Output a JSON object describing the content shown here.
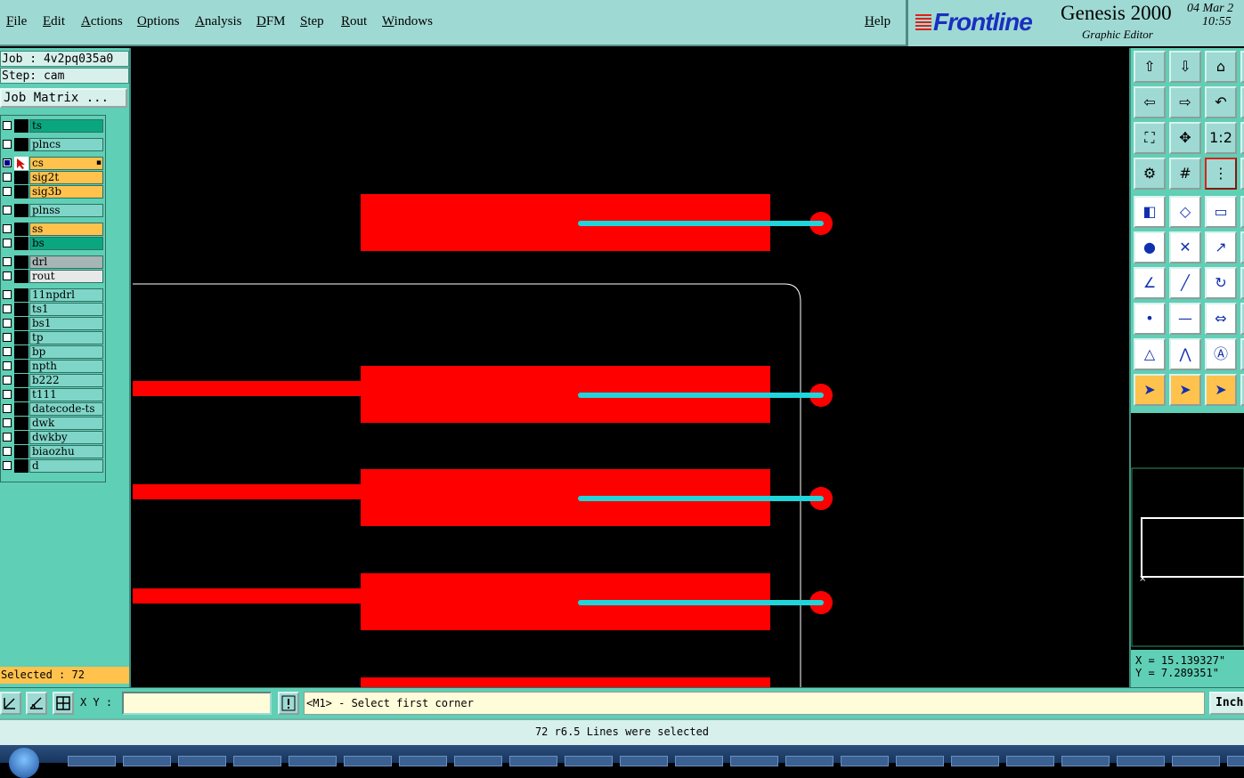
{
  "menu": {
    "items": [
      "File",
      "Edit",
      "Actions",
      "Options",
      "Analysis",
      "DFM",
      "Step",
      "Rout",
      "Windows"
    ],
    "help": "Help"
  },
  "brand": {
    "logo": "Frontline",
    "product": "Genesis 2000",
    "subtitle": "Graphic Editor",
    "date": "04 Mar 2",
    "time": "10:55"
  },
  "job": {
    "job_line": "Job : 4v2pq035a0",
    "step_line": "Step: cam",
    "matrix_button": "Job Matrix ..."
  },
  "layers": [
    {
      "name": "ts",
      "color": "#0aa680"
    },
    {
      "name": "plncs",
      "color": "#7fd6c8"
    },
    {
      "name": "cs",
      "color": "#ffc24d",
      "active": true
    },
    {
      "name": "sig2t",
      "color": "#ffc24d"
    },
    {
      "name": "sig3b",
      "color": "#ffc24d"
    },
    {
      "name": "plnss",
      "color": "#7fd6c8"
    },
    {
      "name": "ss",
      "color": "#ffc24d"
    },
    {
      "name": "bs",
      "color": "#0aa680"
    },
    {
      "name": "drl",
      "color": "#a6b5b5"
    },
    {
      "name": "rout",
      "color": "#e8e8e8"
    },
    {
      "name": "11npdrl",
      "color": "#7fd6c8"
    },
    {
      "name": "ts1",
      "color": "#7fd6c8"
    },
    {
      "name": "bs1",
      "color": "#7fd6c8"
    },
    {
      "name": "tp",
      "color": "#7fd6c8"
    },
    {
      "name": "bp",
      "color": "#7fd6c8"
    },
    {
      "name": "npth",
      "color": "#7fd6c8"
    },
    {
      "name": "b222",
      "color": "#7fd6c8"
    },
    {
      "name": "t111",
      "color": "#7fd6c8"
    },
    {
      "name": "datecode-ts",
      "color": "#7fd6c8"
    },
    {
      "name": "dwk",
      "color": "#7fd6c8"
    },
    {
      "name": "dwkby",
      "color": "#7fd6c8"
    },
    {
      "name": "biaozhu",
      "color": "#7fd6c8"
    },
    {
      "name": "d",
      "color": "#7fd6c8"
    }
  ],
  "selection": {
    "selected_text": "Selected : 72"
  },
  "coords": {
    "x": "X = 15.139327\"",
    "y": "Y = 7.289351\""
  },
  "command": {
    "xy_label": "X Y :",
    "xy_value": "",
    "prompt": "<M1> - Select first corner",
    "unit": "Inch"
  },
  "status": {
    "message": "72 r6.5 Lines were selected"
  },
  "colors": {
    "pad_red": "#ff0000",
    "line_cyan": "#1fd5dc",
    "outline_white": "#ffffff"
  },
  "tools": [
    "top-panel-icon",
    "bottom-panel-icon",
    "home-icon",
    "left-panel-icon",
    "right-panel-icon",
    "undo-view-icon",
    "fit-all-icon",
    "fit-profile-icon",
    "zoom-1-1-icon",
    "settings-icon",
    "grid-icon",
    "net-tracker-icon",
    "snap-icon",
    "edit-shape-icon",
    "measure-icon",
    "connect-icon",
    "cross-icon",
    "move-icon",
    "angle-icon",
    "line-icon",
    "rotate-icon",
    "insert-node-icon",
    "split-icon",
    "resize-icon",
    "polygon-icon",
    "triangle-icon",
    "arc-icon",
    "select-pointer-icon",
    "select-box-icon",
    "select-polygon-icon"
  ]
}
